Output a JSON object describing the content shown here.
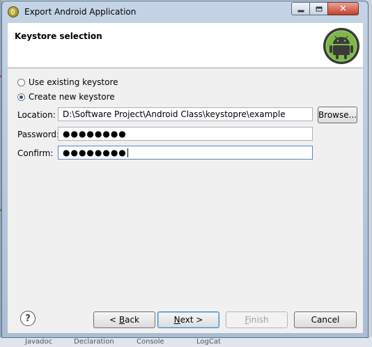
{
  "window": {
    "title": "Export Android Application"
  },
  "header": {
    "title": "Keystore selection"
  },
  "options": {
    "use_existing": "Use existing keystore",
    "create_new": "Create new keystore"
  },
  "form": {
    "location_label": "Location:",
    "location_value": "D:\\Software Project\\Android Class\\keystopre\\example",
    "browse_label": "Browse...",
    "password_label": "Password:",
    "password_mask": "●●●●●●●●",
    "confirm_label": "Confirm:",
    "confirm_mask": "●●●●●●●●"
  },
  "footer": {
    "help": "?",
    "back_pre": "< ",
    "back_key": "B",
    "back_post": "ack",
    "next_key": "N",
    "next_post": "ext >",
    "finish_key": "F",
    "finish_post": "inish",
    "cancel": "Cancel"
  },
  "ide_strip": {
    "tab1": "Javadoc",
    "tab2": "Declaration",
    "tab3": "Console",
    "tab4": "LogCat"
  }
}
